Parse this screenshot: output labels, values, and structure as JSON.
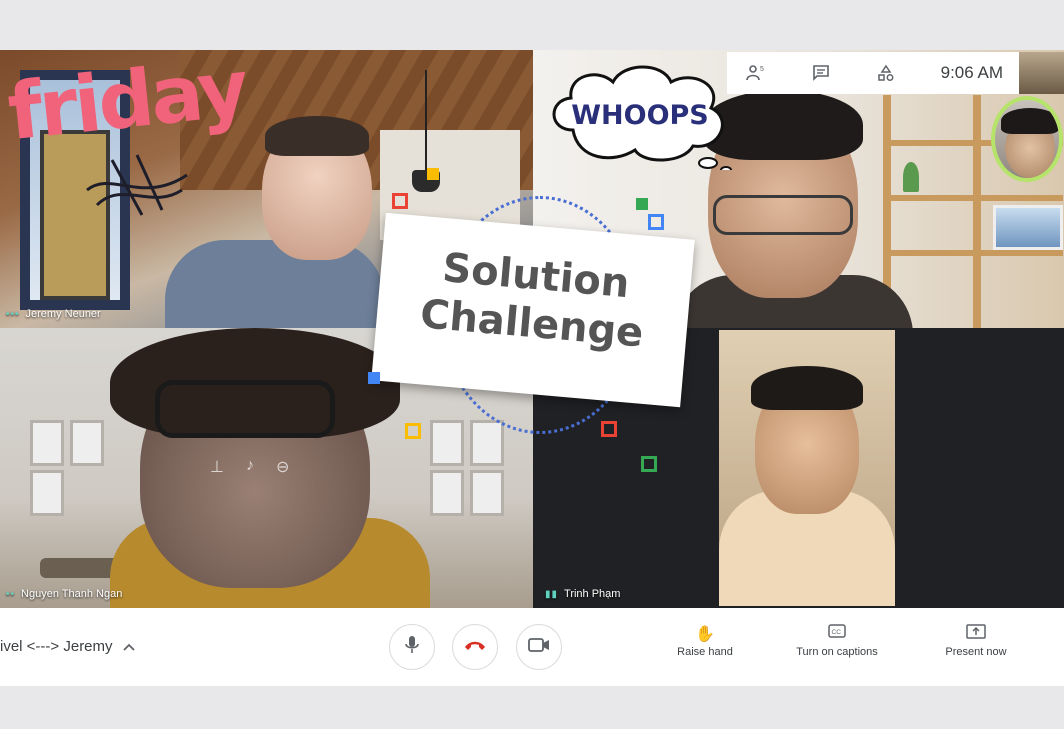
{
  "stickers": {
    "friday": "friday",
    "whoops": "WHOOPS",
    "card_line1": "Solution",
    "card_line2": "Challenge"
  },
  "infobar": {
    "participants_count": "5",
    "time": "9:06 AM"
  },
  "participants": [
    {
      "name": "Jeremy Neuner"
    },
    {
      "name": "Nguyen Thanh Ngan"
    },
    {
      "name": "Trinh Phạm"
    }
  ],
  "controls": {
    "meeting_name": "ivel <---> Jeremy",
    "raise_hand": "Raise hand",
    "captions": "Turn on captions",
    "present": "Present now"
  },
  "colors": {
    "leave_red": "#d93025",
    "sticker_pink": "#f0637a",
    "whoops_navy": "#2a2f7a",
    "self_ring": "#b6e36a"
  },
  "icons": [
    "people-icon",
    "chat-icon",
    "activities-icon",
    "mic-icon",
    "hangup-icon",
    "camera-icon",
    "hand-icon",
    "captions-icon",
    "present-icon",
    "chevron-up-icon"
  ]
}
